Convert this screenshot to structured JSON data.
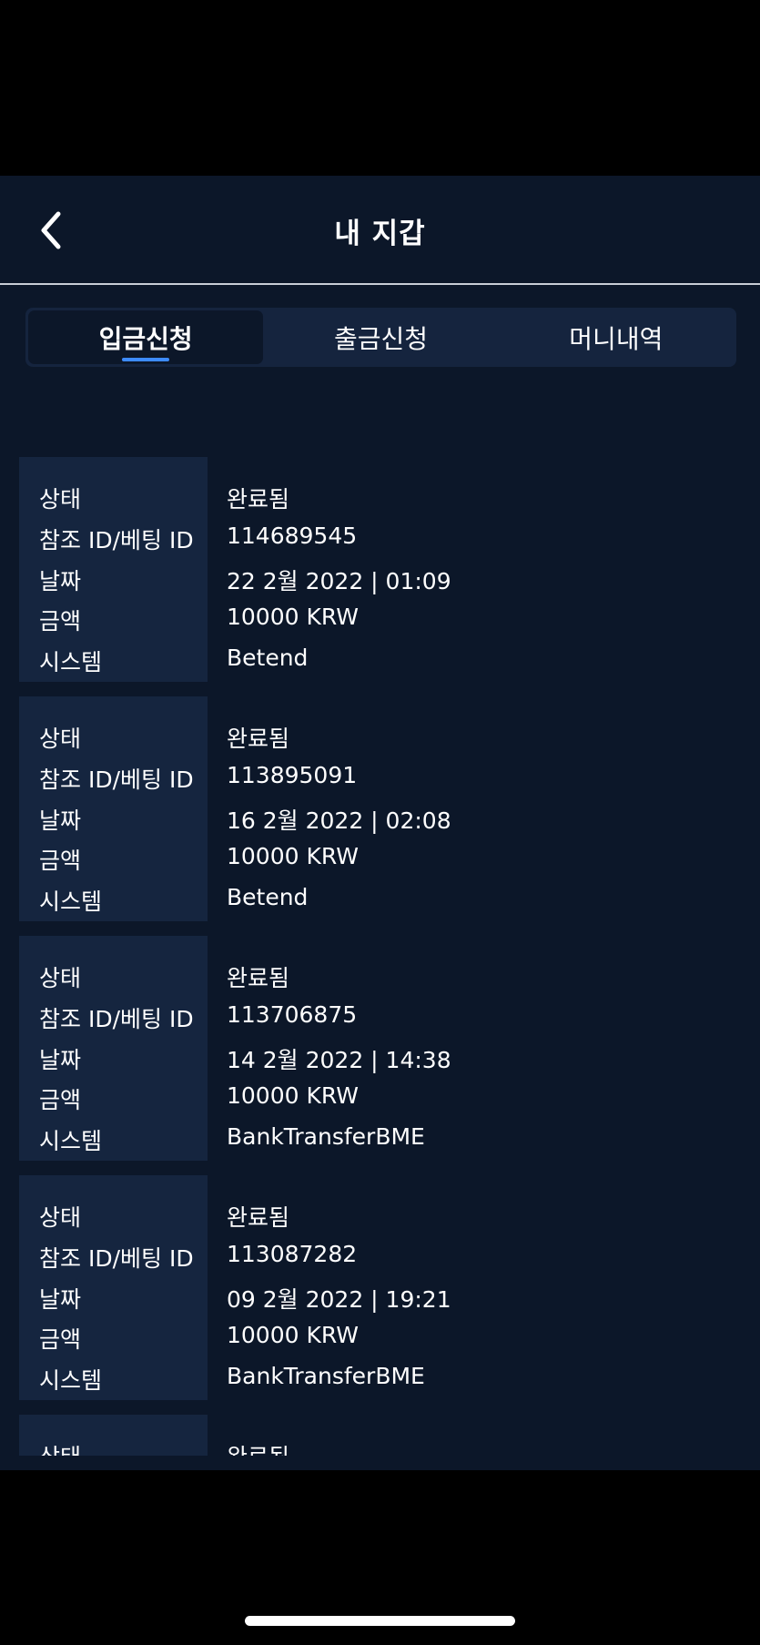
{
  "header": {
    "title": "내 지갑",
    "back_icon": "chevron-left-icon"
  },
  "tabs": [
    {
      "label": "입금신청",
      "active": true
    },
    {
      "label": "출금신청",
      "active": false
    },
    {
      "label": "머니내역",
      "active": false
    }
  ],
  "labels": {
    "status": "상태",
    "reference_id": "참조 ID/베팅 ID",
    "date": "날짜",
    "amount": "금액",
    "system": "시스템"
  },
  "transactions": [
    {
      "status": "완료됨",
      "reference_id": "114689545",
      "date": "22 2월 2022 | 01:09",
      "amount": "10000 KRW",
      "system": "Betend"
    },
    {
      "status": "완료됨",
      "reference_id": "113895091",
      "date": "16 2월 2022 | 02:08",
      "amount": "10000 KRW",
      "system": "Betend"
    },
    {
      "status": "완료됨",
      "reference_id": "113706875",
      "date": "14 2월 2022 | 14:38",
      "amount": "10000 KRW",
      "system": "BankTransferBME"
    },
    {
      "status": "완료됨",
      "reference_id": "113087282",
      "date": "09 2월 2022 | 19:21",
      "amount": "10000 KRW",
      "system": "BankTransferBME"
    },
    {
      "status": "완료됨"
    }
  ],
  "colors": {
    "background": "#0c1729",
    "card_label_bg": "#15253f",
    "tab_bar_bg": "#15243e",
    "accent": "#3d8bff",
    "text": "#ffffff"
  }
}
